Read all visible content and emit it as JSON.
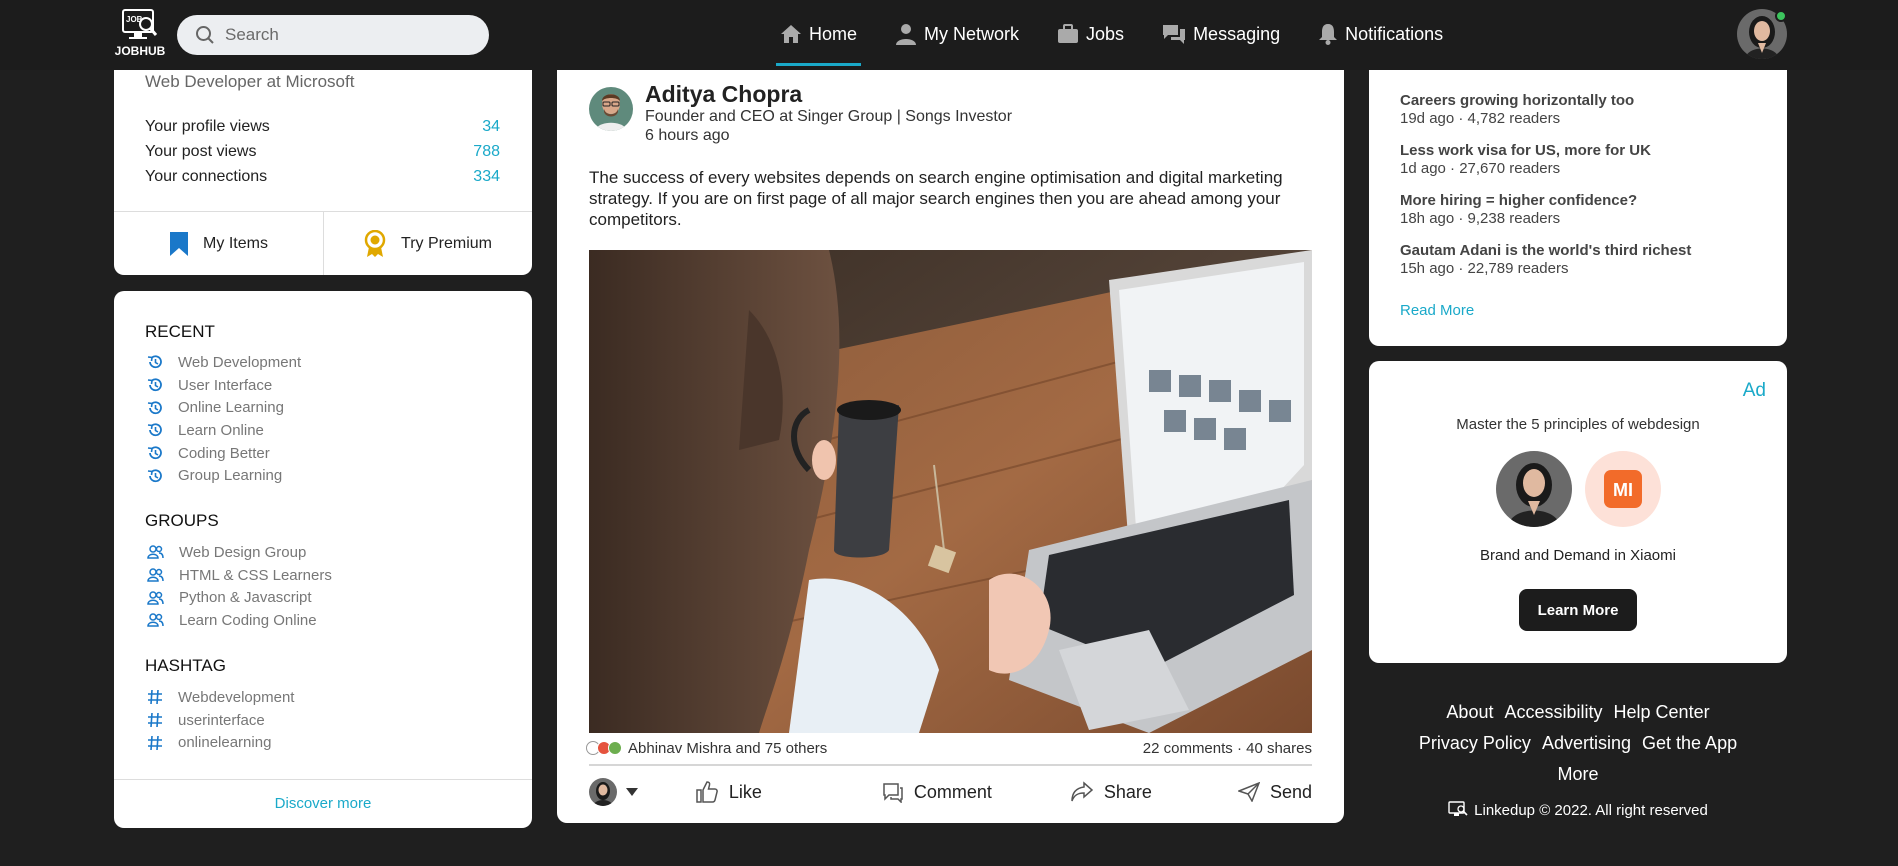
{
  "nav": {
    "logo_text": "JOBHUB",
    "search_placeholder": "Search",
    "items": [
      {
        "label": "Home",
        "icon": "home-icon",
        "active": true
      },
      {
        "label": "My Network",
        "icon": "person-icon"
      },
      {
        "label": "Jobs",
        "icon": "briefcase-icon"
      },
      {
        "label": "Messaging",
        "icon": "chat-icon"
      },
      {
        "label": "Notifications",
        "icon": "bell-icon"
      }
    ]
  },
  "profile": {
    "subtitle": "Web Developer at Microsoft",
    "stats": [
      {
        "label": "Your profile views",
        "value": "34"
      },
      {
        "label": "Your post views",
        "value": "788"
      },
      {
        "label": "Your connections",
        "value": "334"
      }
    ],
    "my_items_label": "My Items",
    "premium_label": "Try Premium"
  },
  "sidebar": {
    "recent_title": "RECENT",
    "recent": [
      "Web Development",
      "User Interface",
      "Online Learning",
      "Learn Online",
      "Coding Better",
      "Group Learning"
    ],
    "groups_title": "GROUPS",
    "groups": [
      "Web Design Group",
      "HTML & CSS Learners",
      "Python & Javascript",
      "Learn Coding Online"
    ],
    "hashtag_title": "HASHTAG",
    "hashtags": [
      "Webdevelopment",
      "userinterface",
      "onlinelearning"
    ],
    "discover_label": "Discover more"
  },
  "post": {
    "author_name": "Aditya Chopra",
    "author_title": "Founder and CEO at Singer Group | Songs Investor",
    "time": "6 hours ago",
    "text": "The success of every websites depends on search engine optimisation and digital marketing strategy. If you are on first page of all major search engines then you are ahead among your competitors.",
    "reactions_text": "Abhinav Mishra and 75 others",
    "stats_text": "22 comments · 40 shares",
    "actions": {
      "like": "Like",
      "comment": "Comment",
      "share": "Share",
      "send": "Send"
    }
  },
  "news": {
    "items": [
      {
        "title": "Careers growing horizontally too",
        "meta": "19d ago · 4,782 readers"
      },
      {
        "title": "Less work visa for US, more for UK",
        "meta": "1d ago · 27,670 readers"
      },
      {
        "title": "More hiring = higher confidence?",
        "meta": "18h ago · 9,238 readers"
      },
      {
        "title": "Gautam Adani is the world's third richest",
        "meta": "15h ago · 22,789 readers"
      }
    ],
    "read_more": "Read More"
  },
  "ad": {
    "label": "Ad",
    "tagline": "Master the 5 principles of webdesign",
    "brand": "Brand and Demand in Xiaomi",
    "button": "Learn More",
    "brand_logo_text": "MI"
  },
  "footer": {
    "links": [
      "About",
      "Accessibility",
      "Help Center",
      "Privacy Policy",
      "Advertising",
      "Get the App",
      "More"
    ],
    "copyright": "Linkedup © 2022. All right reserved"
  },
  "colors": {
    "accent": "#1aa9c9",
    "nav_bg": "#1c1c1c",
    "page_bg": "#1f1f1f"
  }
}
